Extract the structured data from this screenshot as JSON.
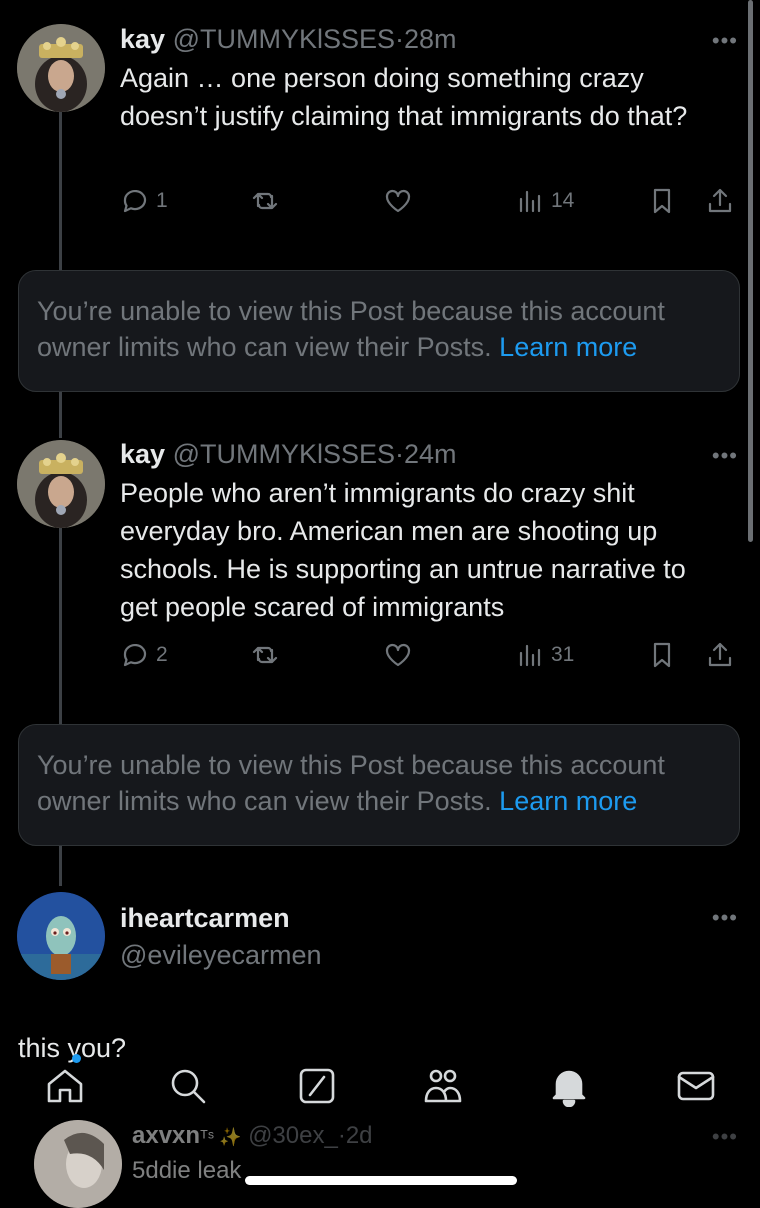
{
  "posts": [
    {
      "name": "kay",
      "handle": "@TUMMYKlSSES",
      "separator": "·",
      "time": "28m",
      "text": "Again … one person doing something crazy doesn’t justify claiming that immigrants do that?",
      "replies": "1",
      "views": "14"
    },
    {
      "name": "kay",
      "handle": "@TUMMYKlSSES",
      "separator": "·",
      "time": "24m",
      "text": "People who aren’t immigrants do crazy shit everyday bro. American men are shooting up schools. He is supporting an untrue narrative to get people scared of immigrants",
      "replies": "2",
      "views": "31"
    }
  ],
  "notices": [
    {
      "text": "You’re unable to view this Post because this account owner limits who can view their Posts. ",
      "link": "Learn more"
    },
    {
      "text": "You’re unable to view this Post because this account owner limits who can view their Posts. ",
      "link": "Learn more"
    }
  ],
  "quoted_post": {
    "name": "iheartcarmen",
    "handle": "@evileyecarmen",
    "text": "this you?"
  },
  "next_post": {
    "name": "axvxn",
    "badge": "ᵀˢ ✨",
    "handle": "@30ex_",
    "separator": "·",
    "time": "2d",
    "text": "5ddie leak"
  },
  "more_label": "•••",
  "icons": {
    "reply": "reply-icon",
    "repost": "repost-icon",
    "like": "heart-icon",
    "views": "views-icon",
    "bookmark": "bookmark-icon",
    "share": "share-icon",
    "nav": [
      "home-icon",
      "search-icon",
      "grok-icon",
      "communities-icon",
      "notifications-icon",
      "messages-icon"
    ]
  },
  "colors": {
    "background": "#000000",
    "text": "#e7e9ea",
    "secondary": "#71767b",
    "link": "#1d9bf0",
    "notice_bg": "#16181c",
    "notification_dot": "#1d9bf0"
  }
}
